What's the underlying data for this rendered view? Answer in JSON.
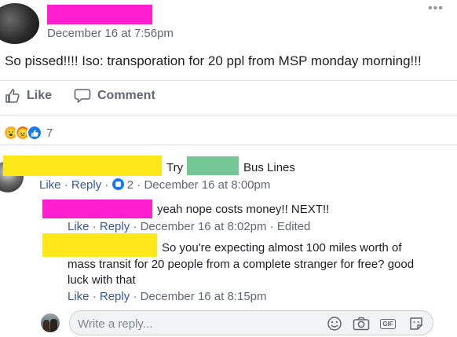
{
  "post": {
    "timestamp": "December 16 at 7:56pm",
    "text": "So pissed!!!! Iso: transporation for 20 ppl from MSP monday morning!!!",
    "actions": {
      "like": "Like",
      "comment": "Comment"
    },
    "reactions": {
      "types": [
        "wow-icon",
        "angry-icon",
        "like-icon"
      ],
      "count": "7"
    }
  },
  "comments": [
    {
      "text_before": "Try",
      "text_after": "Bus Lines",
      "meta": {
        "like": "Like",
        "reply": "Reply",
        "reaction_count": "2",
        "time": "December 16 at 8:00pm",
        "sep": "·"
      }
    }
  ],
  "replies": [
    {
      "text": "yeah nope costs money!! NEXT!!",
      "meta": {
        "like": "Like",
        "reply": "Reply",
        "time": "December 16 at 8:02pm",
        "edited": "Edited",
        "sep": "·"
      }
    },
    {
      "text_line1": "So you're expecting almost 100 miles worth of",
      "text_line2": "mass transit for 20 people from a complete stranger for free? good",
      "text_line3": "luck with that",
      "meta": {
        "like": "Like",
        "reply": "Reply",
        "time": "December 16 at 8:15pm",
        "sep": "·"
      }
    }
  ],
  "reply_box": {
    "placeholder": "Write a reply...",
    "gif_label": "GIF"
  },
  "colors": {
    "link": "#385898",
    "meta": "#606770",
    "accent": "#1877f2"
  }
}
